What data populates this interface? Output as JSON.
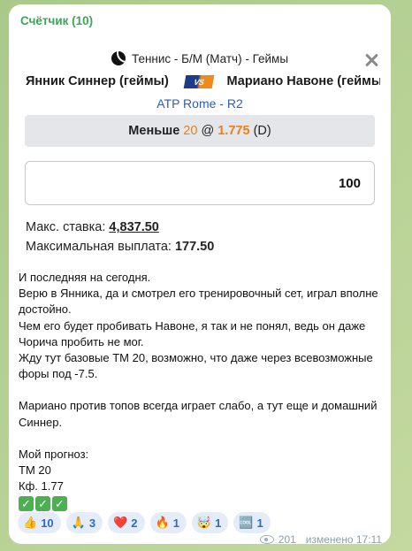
{
  "channel": {
    "name": "Счётчик (10)"
  },
  "bet_widget": {
    "header": "Теннис - Б/М (Матч) - Геймы",
    "team_left": "Янник Синнер (геймы)",
    "vs_label": "VS",
    "team_right": "Мариано Навоне (геймы)",
    "league": "ATP Rome - R2",
    "bet": {
      "label": "Меньше",
      "line": "20",
      "at": "@",
      "odds": "1.775",
      "suffix": "(D)"
    },
    "stake_value": "100",
    "max_stake_label": "Макс. ставка:",
    "max_stake_value": "4,837.50",
    "max_payout_label": "Максимальная выплата:",
    "max_payout_value": "177.50"
  },
  "message": {
    "paragraphs": [
      "И последняя на сегодня.\nВерю в Янника, да и смотрел его тренировочный сет, играл вполне достойно.\nЧем его будет пробивать Навоне, я так и не понял, ведь он даже Чорича пробить не мог.\nЖду тут базовые ТМ 20, возможно, что даже через всевозможные форы под -7.5.",
      "Мариано против топов всегда играет слабо, а тут еще и домашний Синнер.",
      "Мой прогноз:\nТМ 20\nКф. 1.77"
    ]
  },
  "reactions": [
    {
      "emoji": "👍",
      "count": "10"
    },
    {
      "emoji": "🙏",
      "count": "3"
    },
    {
      "emoji": "❤️",
      "count": "2"
    },
    {
      "emoji": "🔥",
      "count": "1"
    },
    {
      "emoji": "🤯",
      "count": "1"
    },
    {
      "emoji": "🆒",
      "count": "1"
    }
  ],
  "meta": {
    "views": "201",
    "edited": "изменено 17:11"
  },
  "colors": {
    "accent_green": "#3aa657",
    "odds_orange": "#ef7d1a",
    "league_blue": "#2d5fb0",
    "reaction_bg": "#e3ecf8"
  }
}
